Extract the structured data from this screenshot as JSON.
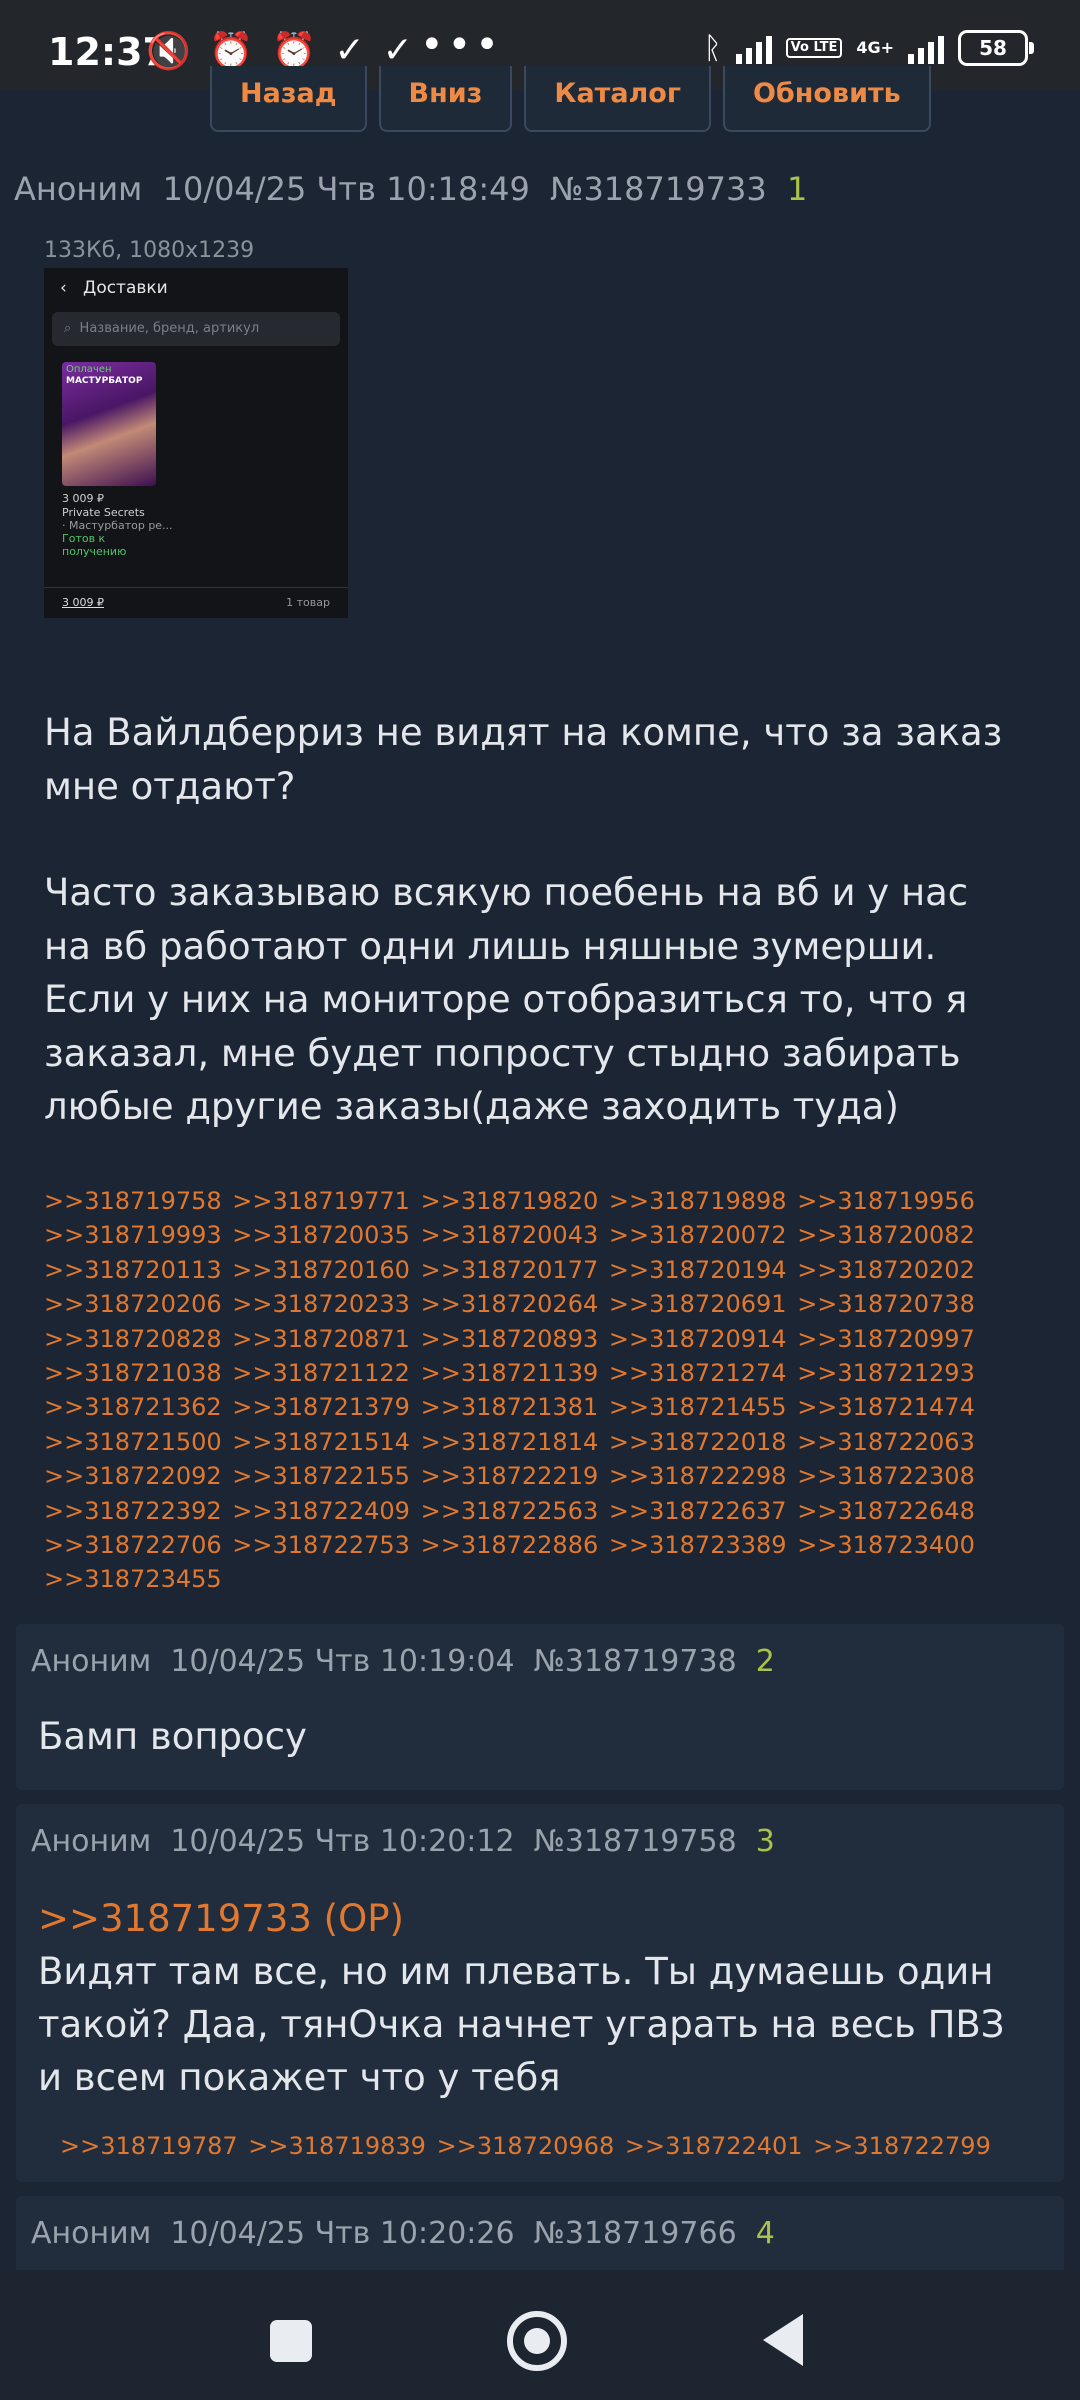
{
  "status_bar": {
    "time": "12:37",
    "left_icons": [
      "mute-vibrate-icon",
      "alarm-icon",
      "alarm-icon",
      "check-icon",
      "check-icon"
    ],
    "more": "•••",
    "volte": "Vo LTE",
    "network": "4G+",
    "battery": "58"
  },
  "nav": {
    "back": "Назад",
    "down": "Вниз",
    "catalog": "Каталог",
    "refresh": "Обновить"
  },
  "op": {
    "author": "Аноним",
    "date": "10/04/25 Чтв 10:18:49",
    "num": "№318719733",
    "index": "1",
    "file_meta": "133Кб, 1080x1239",
    "thumb": {
      "title": "Доставки",
      "search": "Название, бренд, артикул",
      "badge": "Оплачен",
      "product_word": "МАСТУРБАТОР",
      "price": "3 009 ₽",
      "brand": "Private Secrets",
      "desc": "· Мастурбатор ре...",
      "status": "Готов к получению",
      "total": "3 009 ₽",
      "count": "1 товар"
    },
    "paragraph1": "На Вайлдберриз не видят на компе, что за заказ мне отдают?",
    "paragraph2": "Часто заказываю всякую поебень на вб и у нас на вб работают одни лишь няшные зумерши. Если у них на мониторе отобразиться то, что я заказал, мне будет попросту стыдно забирать любые другие заказы(даже заходить туда)",
    "replies": [
      ">>318719758",
      ">>318719771",
      ">>318719820",
      ">>318719898",
      ">>318719956",
      ">>318719993",
      ">>318720035",
      ">>318720043",
      ">>318720072",
      ">>318720082",
      ">>318720113",
      ">>318720160",
      ">>318720177",
      ">>318720194",
      ">>318720202",
      ">>318720206",
      ">>318720233",
      ">>318720264",
      ">>318720691",
      ">>318720738",
      ">>318720828",
      ">>318720871",
      ">>318720893",
      ">>318720914",
      ">>318720997",
      ">>318721038",
      ">>318721122",
      ">>318721139",
      ">>318721274",
      ">>318721293",
      ">>318721362",
      ">>318721379",
      ">>318721381",
      ">>318721455",
      ">>318721474",
      ">>318721500",
      ">>318721514",
      ">>318721814",
      ">>318722018",
      ">>318722063",
      ">>318722092",
      ">>318722155",
      ">>318722219",
      ">>318722298",
      ">>318722308",
      ">>318722392",
      ">>318722409",
      ">>318722563",
      ">>318722637",
      ">>318722648",
      ">>318722706",
      ">>318722753",
      ">>318722886",
      ">>318723389",
      ">>318723400",
      ">>318723455"
    ]
  },
  "posts": [
    {
      "author": "Аноним",
      "date": "10/04/25 Чтв 10:19:04",
      "num": "№318719738",
      "index": "2",
      "text": "Бамп вопросу"
    },
    {
      "author": "Аноним",
      "date": "10/04/25 Чтв 10:20:12",
      "num": "№318719758",
      "index": "3",
      "quote": ">>318719733 (OP)",
      "text": "Видят там все, но им плевать. Ты думаешь один такой? Даа, тянОчка начнет угарать на весь ПВЗ и всем покажет что у тебя",
      "replies": [
        ">>318719787",
        ">>318719839",
        ">>318720968",
        ">>318722401",
        ">>318722799"
      ]
    },
    {
      "author": "Аноним",
      "date": "10/04/25 Чтв 10:20:26",
      "num": "№318719766",
      "index": "4"
    }
  ]
}
